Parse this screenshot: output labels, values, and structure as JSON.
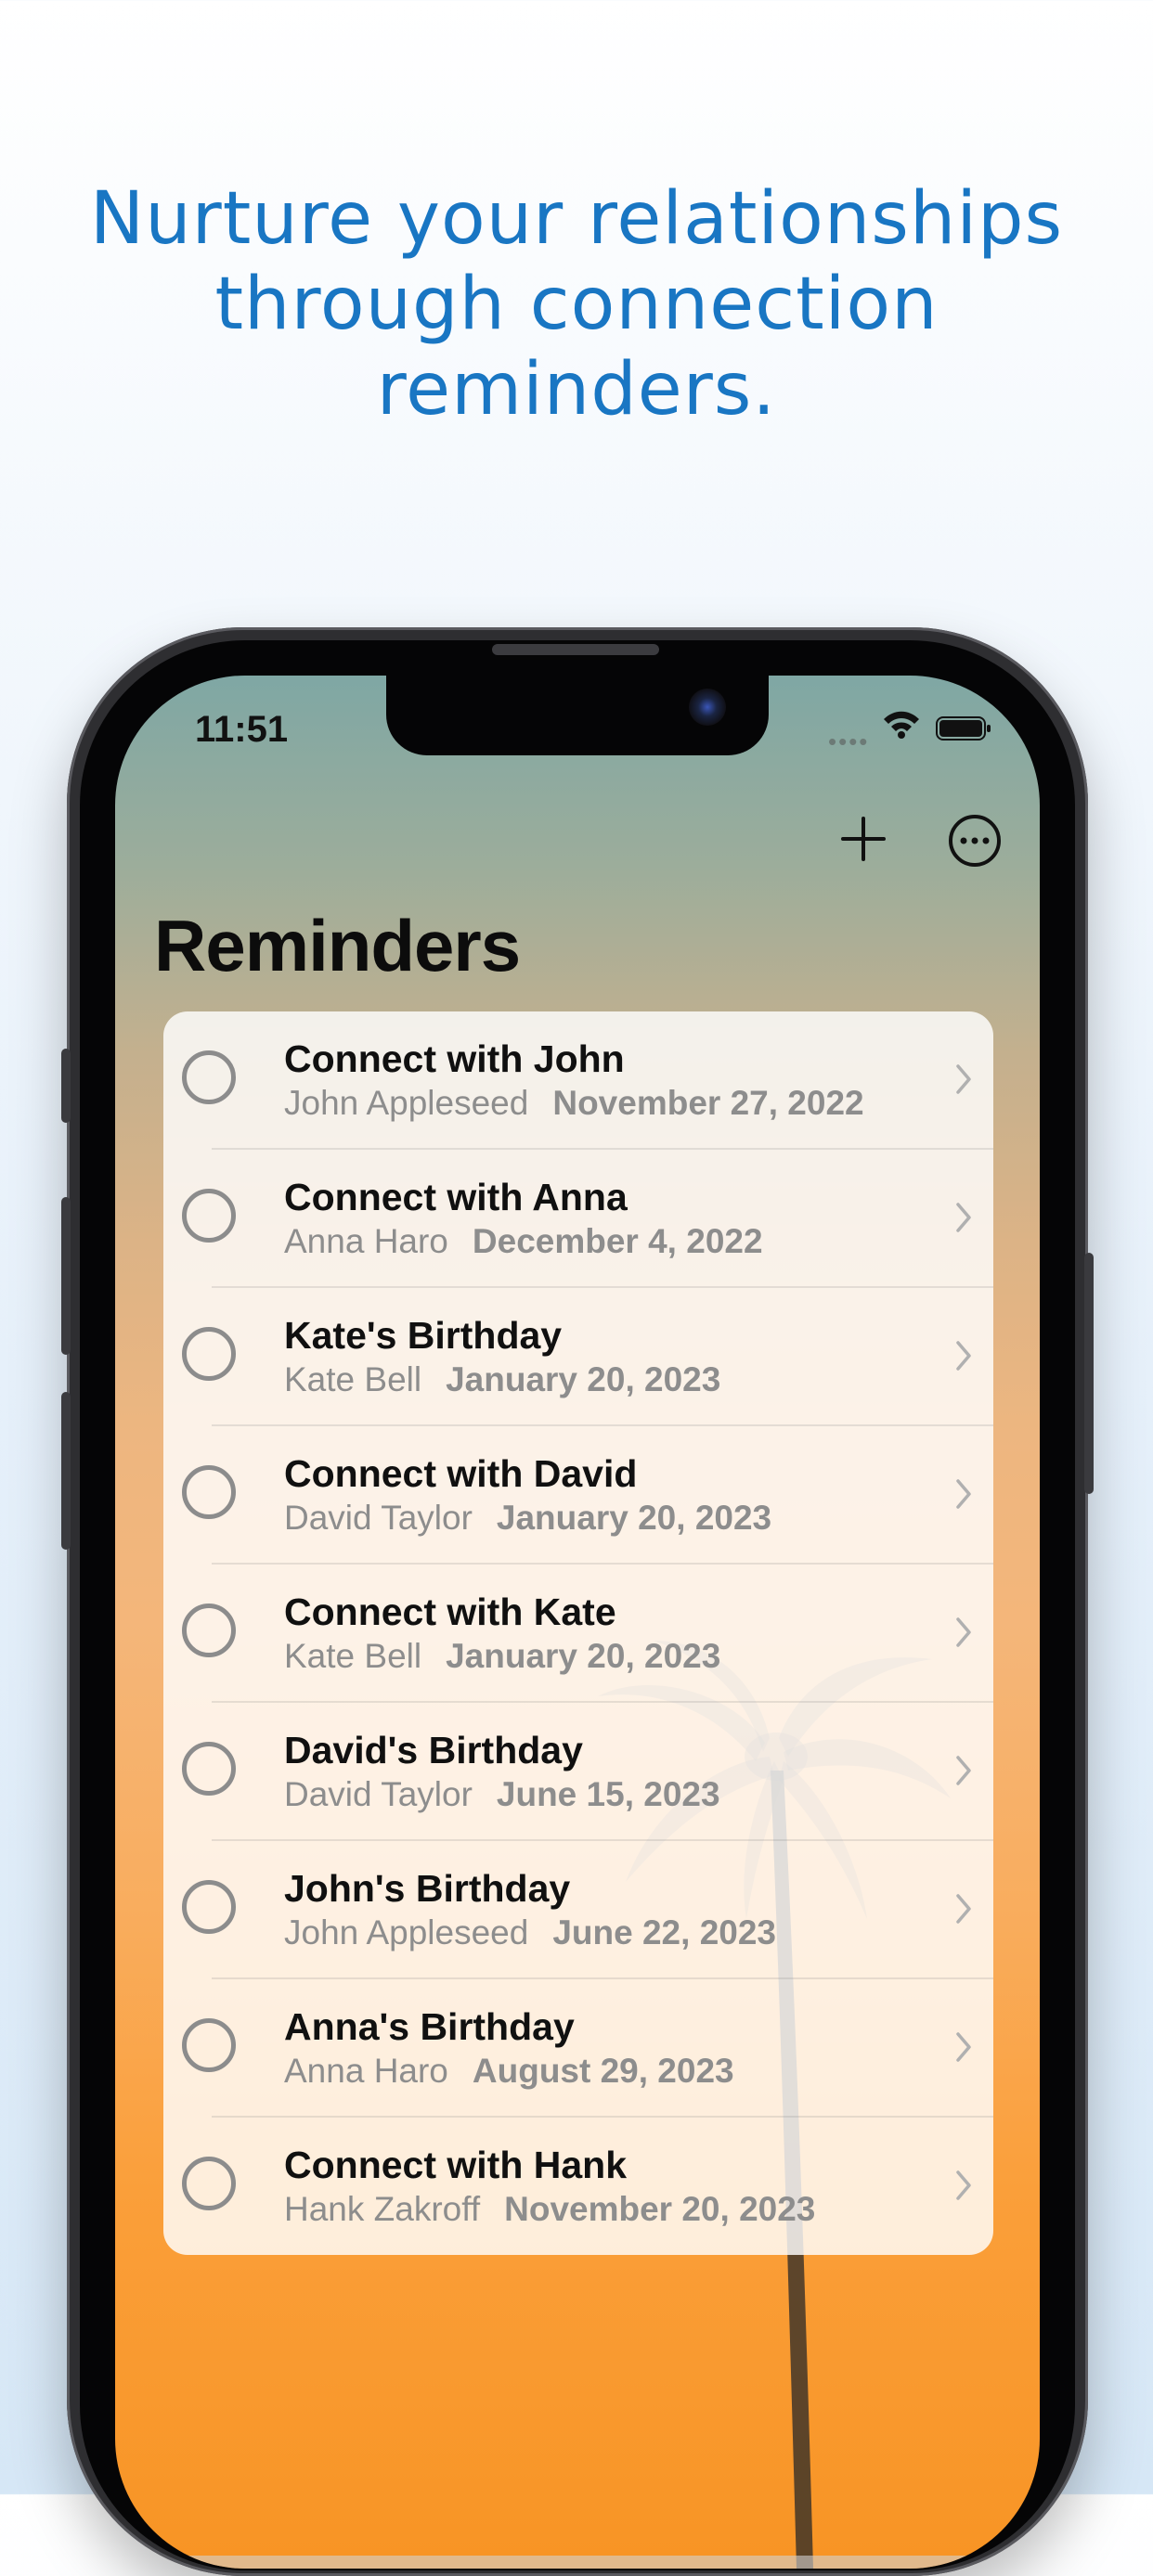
{
  "headline": {
    "line1": "Nurture your relationships",
    "line2": "through connection",
    "line3": "reminders."
  },
  "status_bar": {
    "time": "11:51",
    "icons": [
      "signal-icon",
      "wifi-icon",
      "battery-icon"
    ]
  },
  "nav": {
    "title": "Reminders",
    "actions": [
      "plus-icon",
      "more-icon"
    ]
  },
  "reminders": [
    {
      "title": "Connect with John",
      "person": "John Appleseed",
      "date": "November 27, 2022"
    },
    {
      "title": "Connect with Anna",
      "person": "Anna Haro",
      "date": "December 4, 2022"
    },
    {
      "title": "Kate's Birthday",
      "person": "Kate Bell",
      "date": "January 20, 2023"
    },
    {
      "title": "Connect with David",
      "person": "David Taylor",
      "date": "January 20, 2023"
    },
    {
      "title": "Connect with Kate",
      "person": "Kate Bell",
      "date": "January 20, 2023"
    },
    {
      "title": "David's Birthday",
      "person": "David Taylor",
      "date": "June 15, 2023"
    },
    {
      "title": "John's Birthday",
      "person": "John Appleseed",
      "date": "June 22, 2023"
    },
    {
      "title": "Anna's Birthday",
      "person": "Anna Haro",
      "date": "August 29, 2023"
    },
    {
      "title": "Connect with Hank",
      "person": "Hank Zakroff",
      "date": "November 20, 2023"
    }
  ],
  "colors": {
    "headline": "#1976c3",
    "accent_orange": "#f89424"
  }
}
